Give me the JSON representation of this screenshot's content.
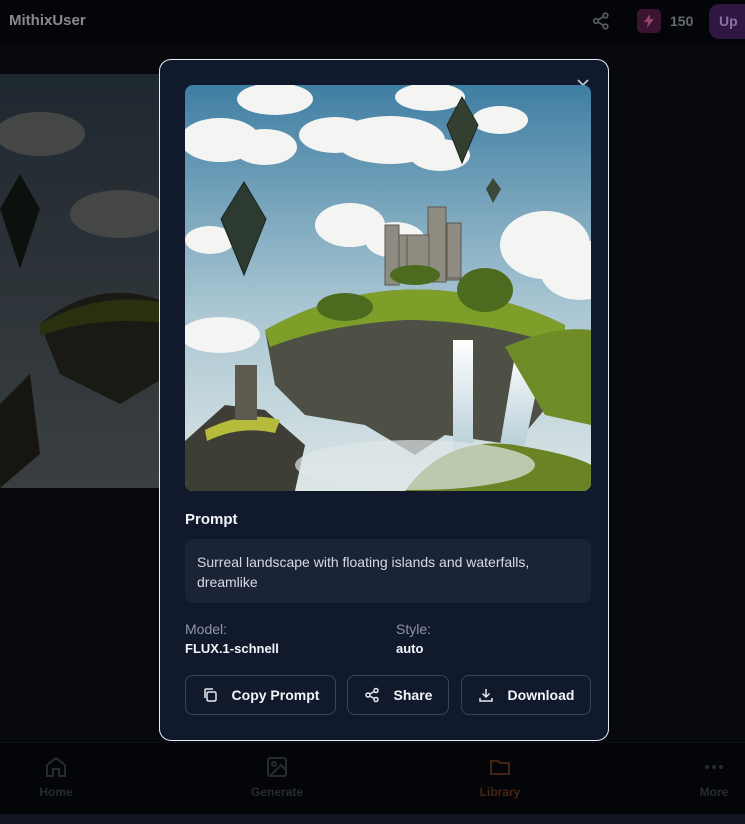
{
  "header": {
    "username": "MithixUser",
    "credits": "150",
    "upgrade_label": "Up"
  },
  "nav": [
    {
      "label": "Home",
      "icon": "home-icon"
    },
    {
      "label": "Generate",
      "icon": "image-icon"
    },
    {
      "label": "Library",
      "icon": "folder-icon",
      "active": true
    },
    {
      "label": "More",
      "icon": "more-dots-icon"
    }
  ],
  "modal": {
    "prompt_heading": "Prompt",
    "prompt_text": "Surreal landscape with floating islands and waterfalls, dreamlike",
    "model_label": "Model:",
    "model_value": "FLUX.1-schnell",
    "style_label": "Style:",
    "style_value": "auto",
    "buttons": {
      "copy": "Copy Prompt",
      "share": "Share",
      "download": "Download"
    }
  },
  "colors": {
    "accent_active": "#f59e0b",
    "upgrade_bg": "#9333ea",
    "modal_bg": "#111a2c"
  }
}
